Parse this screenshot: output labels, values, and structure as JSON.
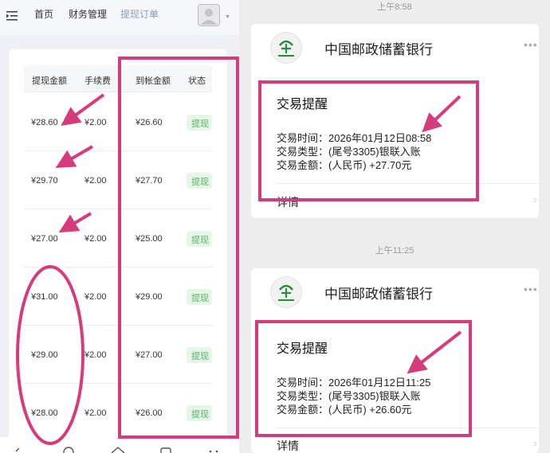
{
  "admin": {
    "nav": [
      "首页",
      "财务管理",
      "提现订单"
    ],
    "columns": [
      "提现金额",
      "手续费",
      "到帐金额",
      "状态"
    ],
    "rows": [
      {
        "amount": "¥28.60",
        "fee": "¥2.00",
        "received": "¥26.60",
        "status": "提现"
      },
      {
        "amount": "¥29.70",
        "fee": "¥2.00",
        "received": "¥27.70",
        "status": "提现"
      },
      {
        "amount": "¥27.00",
        "fee": "¥2.00",
        "received": "¥25.00",
        "status": "提现"
      },
      {
        "amount": "¥31.00",
        "fee": "¥2.00",
        "received": "¥29.00",
        "status": "提现"
      },
      {
        "amount": "¥29.00",
        "fee": "¥2.00",
        "received": "¥27.00",
        "status": "提现"
      },
      {
        "amount": "¥28.00",
        "fee": "¥2.00",
        "received": "¥26.00",
        "status": "提现"
      }
    ]
  },
  "chat": {
    "messages": [
      {
        "time": "上午8:58",
        "sender": "中国邮政储蓄银行",
        "title": "交易提醒",
        "lines": [
          "交易时间：2026年01月12日08:58",
          "交易类型：(尾号3305)银联入账",
          "交易金额：(人民币) +27.70元"
        ],
        "detail": "详情"
      },
      {
        "time": "上午11:25",
        "sender": "中国邮政储蓄银行",
        "title": "交易提醒",
        "lines": [
          "交易时间：2026年01月12日11:25",
          "交易类型：(尾号3305)银联入账",
          "交易金额：(人民币) +26.60元"
        ],
        "detail": "详情"
      }
    ]
  },
  "colors": {
    "annotation": "#d63c7c",
    "status_bg": "#e6f7e8",
    "status_text": "#58b068",
    "nav_active": "#8a9bb8"
  }
}
